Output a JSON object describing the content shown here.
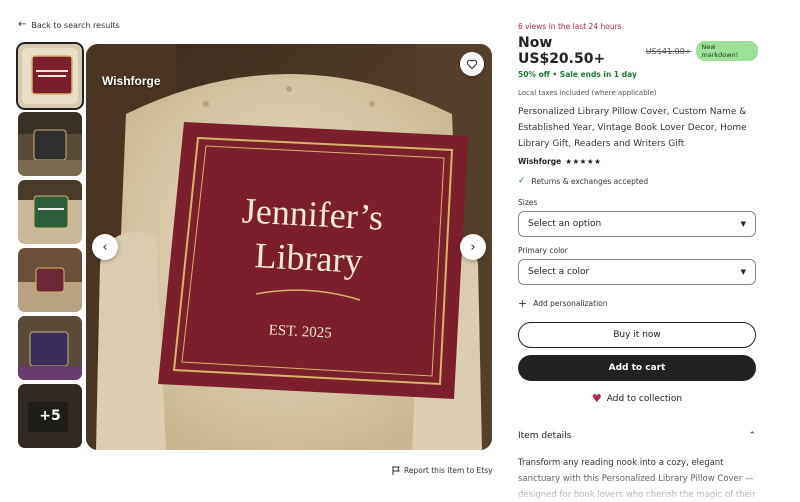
{
  "nav": {
    "back_label": "Back to search results",
    "back_icon": "arrow-left-icon"
  },
  "gallery": {
    "brand_mark": "Wishforge",
    "more_count": "+5",
    "pillow_line1": "Jennifer’s",
    "pillow_line2": "Library",
    "pillow_est": "EST. 2025",
    "thumbs": [
      {
        "colors": [
          "#7a1f2b",
          "#d6c6a5"
        ]
      },
      {
        "colors": [
          "#3a3a3a",
          "#6a5640"
        ]
      },
      {
        "colors": [
          "#2f5e3c",
          "#cfc1a0"
        ]
      },
      {
        "colors": [
          "#6b2836",
          "#8c6b4a"
        ]
      },
      {
        "colors": [
          "#3b2e5a",
          "#5c4a38"
        ]
      },
      {
        "colors": [
          "#3a3631",
          "#5b4e3e"
        ]
      }
    ]
  },
  "report": {
    "label": "Report this item to Etsy",
    "icon": "flag-icon"
  },
  "product": {
    "views_text": "6 views in the last 24 hours",
    "price_now": "Now US$20.50+",
    "price_old": "US$41.00+",
    "badge": "New markdown!",
    "sale_text": "50% off • Sale ends in 1 day",
    "tax_note": "Local taxes included (where applicable)",
    "title": "Personalized Library Pillow Cover, Custom Name & Established Year, Vintage Book Lover Decor, Home Library Gift, Readers and Writers Gift",
    "shop_name": "Wishforge",
    "stars": "★★★★★",
    "returns": "Returns & exchanges accepted"
  },
  "options": {
    "sizes_label": "Sizes",
    "sizes_placeholder": "Select an option",
    "color_label": "Primary color",
    "color_placeholder": "Select a color",
    "personalization": "Add personalization"
  },
  "actions": {
    "buy_now": "Buy it now",
    "add_to_cart": "Add to cart",
    "add_to_collection": "Add to collection"
  },
  "details": {
    "heading": "Item details",
    "description": "Transform any reading nook into a cozy, elegant sanctuary with this Personalized Library Pillow Cover — designed for book lovers who cherish the magic of their own sacred reading space."
  },
  "colors": {
    "accent_red": "#b3254b",
    "sale_green": "#1b7a33",
    "badge_green": "#9de09a",
    "pillow_burgundy": "#7a1f2b",
    "gold_trim": "#d8b46a",
    "dark_button": "#222222"
  }
}
